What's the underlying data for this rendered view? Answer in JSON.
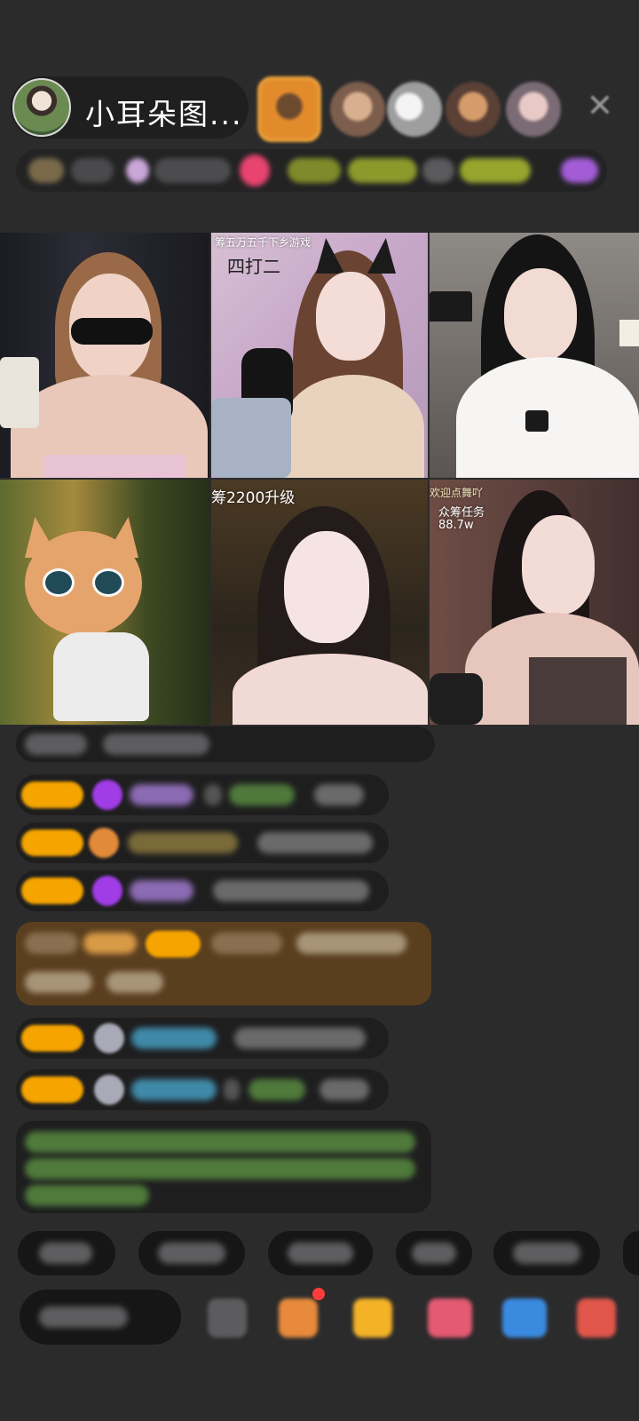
{
  "host": {
    "name": "小耳朵图..."
  },
  "grid": {
    "tiles": [
      {
        "id": "host-1",
        "captions": []
      },
      {
        "id": "host-2",
        "captions": [
          "筹五万五千下乡游戏",
          "四打二"
        ]
      },
      {
        "id": "host-3",
        "captions": []
      },
      {
        "id": "host-4",
        "captions": []
      },
      {
        "id": "host-5",
        "captions": [
          "筹2200升级"
        ]
      },
      {
        "id": "host-6",
        "captions": [
          "欢迎点舞吖",
          "众筹任务",
          "88.7w"
        ]
      }
    ]
  },
  "colors": {
    "background": "#2b2b2c",
    "badge": "#f5a400",
    "gift_highlight": "#5a3f1f",
    "notification": "#ff3b3b"
  },
  "icons": [
    "close-icon",
    "gift-box-icon",
    "red-packet-icon",
    "more-icon"
  ]
}
